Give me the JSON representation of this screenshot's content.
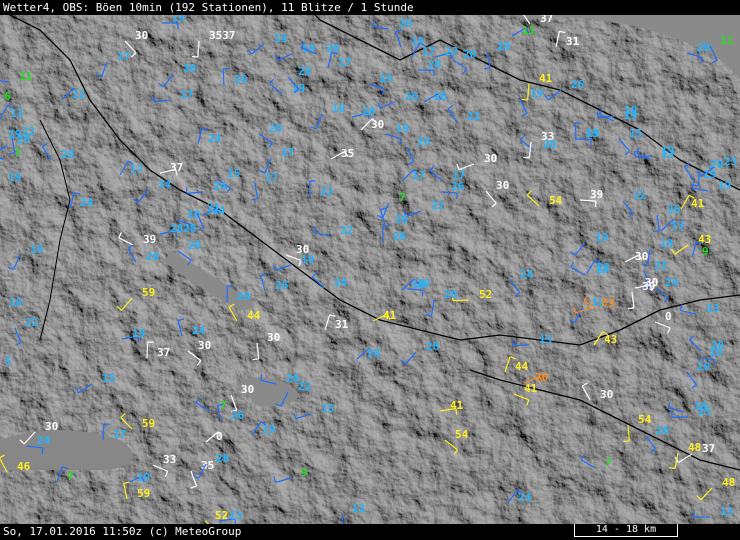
{
  "header": {
    "title": "Wetter4, OBS: Böen 10min (192 Stationen), 11 Blitze / 1 Stunde"
  },
  "footer": {
    "timestamp": "So, 17.01.2016 11:50z (c) MeteoGroup",
    "scale_label": "14 - 18 km"
  },
  "legend_colors": {
    "white": "#ffffff",
    "cyan": "#22b4ff",
    "green": "#22dd22",
    "yellow": "#ffee22",
    "orange": "#ff8a1a",
    "red": "#ff2a1a",
    "blue_barb": "#1e6eff"
  },
  "stations": [
    {
      "v": "19",
      "c": "cyan"
    },
    {
      "v": "30",
      "c": "white"
    },
    {
      "v": "3537",
      "c": "white"
    },
    {
      "v": "19",
      "c": "cyan"
    },
    {
      "v": "28",
      "c": "cyan"
    },
    {
      "v": "37",
      "c": "white"
    },
    {
      "v": "31",
      "c": "white"
    },
    {
      "v": "11",
      "c": "green"
    },
    {
      "v": "20",
      "c": "cyan"
    },
    {
      "v": "11",
      "c": "green"
    },
    {
      "v": "17",
      "c": "cyan"
    },
    {
      "v": "19",
      "c": "cyan"
    },
    {
      "v": "20",
      "c": "cyan"
    },
    {
      "v": "28",
      "c": "cyan"
    },
    {
      "v": "17",
      "c": "cyan"
    },
    {
      "v": "22",
      "c": "cyan"
    },
    {
      "v": "20",
      "c": "cyan"
    },
    {
      "v": "28",
      "c": "cyan"
    },
    {
      "v": "20",
      "c": "cyan"
    },
    {
      "v": "17",
      "c": "cyan"
    },
    {
      "v": "19",
      "c": "cyan"
    },
    {
      "v": "26",
      "c": "cyan"
    },
    {
      "v": "22",
      "c": "cyan"
    },
    {
      "v": "26",
      "c": "cyan"
    },
    {
      "v": "28",
      "c": "cyan"
    },
    {
      "v": "41",
      "c": "yellow"
    },
    {
      "v": "26",
      "c": "cyan"
    },
    {
      "v": "11",
      "c": "green"
    },
    {
      "v": "22",
      "c": "cyan"
    },
    {
      "v": "17",
      "c": "cyan"
    },
    {
      "v": "26",
      "c": "cyan"
    },
    {
      "v": "19",
      "c": "cyan"
    },
    {
      "v": "19",
      "c": "cyan"
    },
    {
      "v": "19",
      "c": "cyan"
    },
    {
      "v": "26",
      "c": "cyan"
    },
    {
      "v": "19",
      "c": "cyan"
    },
    {
      "v": "6",
      "c": "green"
    },
    {
      "v": "13",
      "c": "cyan"
    },
    {
      "v": "20",
      "c": "cyan"
    },
    {
      "v": "20",
      "c": "cyan"
    },
    {
      "v": "22",
      "c": "cyan"
    },
    {
      "v": "29",
      "c": "cyan"
    },
    {
      "v": "29",
      "c": "cyan"
    },
    {
      "v": "20",
      "c": "cyan"
    },
    {
      "v": "19",
      "c": "cyan"
    },
    {
      "v": "30",
      "c": "white"
    },
    {
      "v": "13",
      "c": "cyan"
    },
    {
      "v": "15",
      "c": "cyan"
    },
    {
      "v": "33",
      "c": "white"
    },
    {
      "v": "20",
      "c": "cyan"
    },
    {
      "v": "7",
      "c": "green"
    },
    {
      "v": "28",
      "c": "cyan"
    },
    {
      "v": "24",
      "c": "cyan"
    },
    {
      "v": "35",
      "c": "white"
    },
    {
      "v": "19",
      "c": "cyan"
    },
    {
      "v": "26",
      "c": "cyan"
    },
    {
      "v": "17",
      "c": "cyan"
    },
    {
      "v": "30",
      "c": "white"
    },
    {
      "v": "13",
      "c": "cyan"
    },
    {
      "v": "19",
      "c": "cyan"
    },
    {
      "v": "17",
      "c": "cyan"
    },
    {
      "v": "37",
      "c": "white"
    },
    {
      "v": "15",
      "c": "cyan"
    },
    {
      "v": "17",
      "c": "cyan"
    },
    {
      "v": "24",
      "c": "cyan"
    },
    {
      "v": "24",
      "c": "cyan"
    },
    {
      "v": "17",
      "c": "cyan"
    },
    {
      "v": "22",
      "c": "cyan"
    },
    {
      "v": "17",
      "c": "cyan"
    },
    {
      "v": "26",
      "c": "cyan"
    },
    {
      "v": "30",
      "c": "white"
    },
    {
      "v": "20",
      "c": "cyan"
    },
    {
      "v": "23",
      "c": "cyan"
    },
    {
      "v": "19",
      "c": "cyan"
    },
    {
      "v": "19",
      "c": "cyan"
    },
    {
      "v": "24",
      "c": "cyan"
    },
    {
      "v": "24",
      "c": "cyan"
    },
    {
      "v": "28",
      "c": "cyan"
    },
    {
      "v": "21",
      "c": "cyan"
    },
    {
      "v": "7",
      "c": "green"
    },
    {
      "v": "22",
      "c": "cyan"
    },
    {
      "v": "39",
      "c": "white"
    },
    {
      "v": "26",
      "c": "cyan"
    },
    {
      "v": "41",
      "c": "yellow"
    },
    {
      "v": "2828",
      "c": "cyan"
    },
    {
      "v": "20",
      "c": "cyan"
    },
    {
      "v": "26",
      "c": "cyan"
    },
    {
      "v": "19",
      "c": "cyan"
    },
    {
      "v": "19",
      "c": "cyan"
    },
    {
      "v": "54",
      "c": "yellow"
    },
    {
      "v": "26",
      "c": "cyan"
    },
    {
      "v": "13",
      "c": "cyan"
    },
    {
      "v": "39",
      "c": "white"
    },
    {
      "v": "22",
      "c": "cyan"
    },
    {
      "v": "19",
      "c": "cyan"
    },
    {
      "v": "43",
      "c": "yellow"
    },
    {
      "v": "22",
      "c": "cyan"
    },
    {
      "v": "20",
      "c": "cyan"
    },
    {
      "v": "9",
      "c": "green"
    },
    {
      "v": "30",
      "c": "white"
    },
    {
      "v": "30",
      "c": "white"
    },
    {
      "v": "22",
      "c": "cyan"
    },
    {
      "v": "19",
      "c": "cyan"
    },
    {
      "v": "10",
      "c": "cyan"
    },
    {
      "v": "13",
      "c": "cyan"
    },
    {
      "v": "26",
      "c": "cyan"
    },
    {
      "v": "22",
      "c": "cyan"
    },
    {
      "v": "30",
      "c": "white"
    },
    {
      "v": "24",
      "c": "cyan"
    },
    {
      "v": "39",
      "c": "white"
    },
    {
      "v": "59",
      "c": "yellow"
    },
    {
      "v": "52",
      "c": "yellow"
    },
    {
      "v": "24",
      "c": "cyan"
    },
    {
      "v": "20",
      "c": "cyan"
    },
    {
      "v": "19",
      "c": "cyan"
    },
    {
      "v": "20",
      "c": "cyan"
    },
    {
      "v": "24",
      "c": "cyan"
    },
    {
      "v": "20",
      "c": "cyan"
    },
    {
      "v": "19",
      "c": "cyan"
    },
    {
      "v": "13",
      "c": "cyan"
    },
    {
      "v": "44",
      "c": "yellow"
    },
    {
      "v": "31",
      "c": "white"
    },
    {
      "v": "41",
      "c": "yellow"
    },
    {
      "v": "0",
      "c": "white"
    },
    {
      "v": "22",
      "c": "cyan"
    },
    {
      "v": "19",
      "c": "cyan"
    },
    {
      "v": "8",
      "c": "orange"
    },
    {
      "v": "3",
      "c": "orange"
    },
    {
      "v": "24",
      "c": "cyan"
    },
    {
      "v": "43",
      "c": "yellow"
    },
    {
      "v": "19",
      "c": "cyan"
    },
    {
      "v": "30",
      "c": "white"
    },
    {
      "v": "30",
      "c": "white"
    },
    {
      "v": "28",
      "c": "cyan"
    },
    {
      "v": "15",
      "c": "cyan"
    },
    {
      "v": "20",
      "c": "cyan"
    },
    {
      "v": "37",
      "c": "white"
    },
    {
      "v": "28",
      "c": "cyan"
    },
    {
      "v": "19",
      "c": "cyan"
    },
    {
      "v": "20",
      "c": "cyan"
    },
    {
      "v": "5",
      "c": "cyan"
    },
    {
      "v": "15",
      "c": "cyan"
    },
    {
      "v": "20",
      "c": "cyan"
    },
    {
      "v": "30",
      "c": "white"
    },
    {
      "v": "44",
      "c": "yellow"
    },
    {
      "v": "70",
      "c": "orange"
    },
    {
      "v": "41",
      "c": "yellow"
    },
    {
      "v": "30",
      "c": "white"
    },
    {
      "v": "22",
      "c": "cyan"
    },
    {
      "v": "15",
      "c": "cyan"
    },
    {
      "v": "7",
      "c": "green"
    },
    {
      "v": "26",
      "c": "cyan"
    },
    {
      "v": "19",
      "c": "cyan"
    },
    {
      "v": "41",
      "c": "yellow"
    },
    {
      "v": "54",
      "c": "yellow"
    },
    {
      "v": "54",
      "c": "yellow"
    },
    {
      "v": "30",
      "c": "white"
    },
    {
      "v": "15",
      "c": "cyan"
    },
    {
      "v": "59",
      "c": "yellow"
    },
    {
      "v": "17",
      "c": "cyan"
    },
    {
      "v": "0",
      "c": "white"
    },
    {
      "v": "24",
      "c": "cyan"
    },
    {
      "v": "26",
      "c": "cyan"
    },
    {
      "v": "48",
      "c": "yellow"
    },
    {
      "v": "37",
      "c": "white"
    },
    {
      "v": "19",
      "c": "cyan"
    },
    {
      "v": "46",
      "c": "yellow"
    },
    {
      "v": "7",
      "c": "green"
    },
    {
      "v": "19",
      "c": "cyan"
    },
    {
      "v": "33",
      "c": "white"
    },
    {
      "v": "35",
      "c": "white"
    },
    {
      "v": "20",
      "c": "cyan"
    },
    {
      "v": "9",
      "c": "green"
    },
    {
      "v": "7",
      "c": "green"
    },
    {
      "v": "59",
      "c": "yellow"
    },
    {
      "v": "24",
      "c": "cyan"
    },
    {
      "v": "13",
      "c": "cyan"
    },
    {
      "v": "52",
      "c": "yellow"
    },
    {
      "v": "13",
      "c": "cyan"
    },
    {
      "v": "48",
      "c": "yellow"
    },
    {
      "v": "13",
      "c": "cyan"
    }
  ]
}
